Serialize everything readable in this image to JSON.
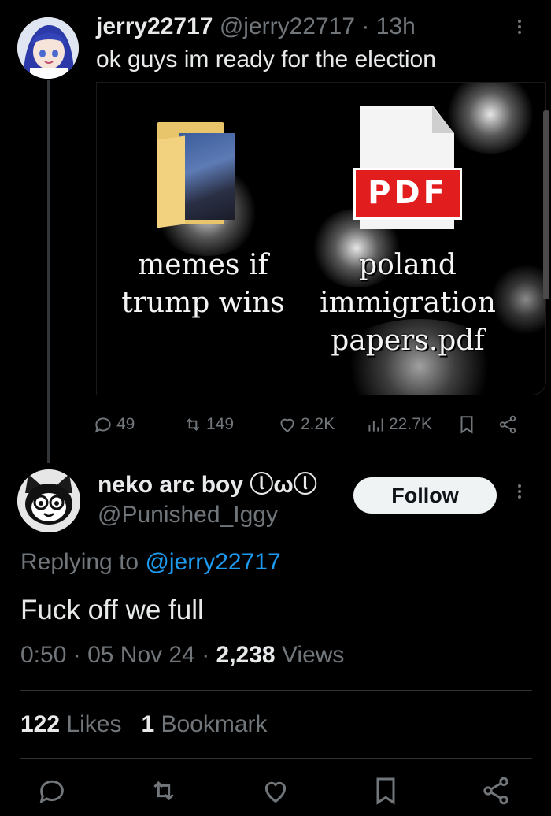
{
  "parent_tweet": {
    "display_name": "jerry22717",
    "handle": "@jerry22717",
    "separator": "·",
    "time": "13h",
    "text": "ok guys im ready for the election",
    "media": {
      "folder_label": "memes if trump wins",
      "pdf_badge": "PDF",
      "pdf_label": "poland immigration papers.pdf"
    },
    "actions": {
      "replies": "49",
      "reposts": "149",
      "likes": "2.2K",
      "views": "22.7K"
    }
  },
  "reply_tweet": {
    "display_name": "neko arc boy ⓛωⓛ",
    "handle": "@Punished_Iggy",
    "follow_label": "Follow",
    "replying_prefix": "Replying to",
    "replying_mention": "@jerry22717",
    "text": "Fuck off we full",
    "time": "0:50",
    "date": "05 Nov 24",
    "views_count": "2,238",
    "views_label": "Views",
    "meta_sep": "·",
    "likes_count": "122",
    "likes_label": "Likes",
    "bookmarks_count": "1",
    "bookmarks_label": "Bookmark"
  },
  "icons": {
    "reply": "speech-bubble-icon",
    "repost": "repost-icon",
    "like": "heart-icon",
    "views": "bar-chart-icon",
    "bookmark": "bookmark-icon",
    "share": "share-icon",
    "more": "vertical-dots-icon"
  },
  "colors": {
    "background": "#000000",
    "text": "#e7e9ea",
    "muted": "#71767b",
    "link": "#1d9bf0",
    "pdf_red": "#e11d1d",
    "folder_yellow": "#e8c46a"
  }
}
